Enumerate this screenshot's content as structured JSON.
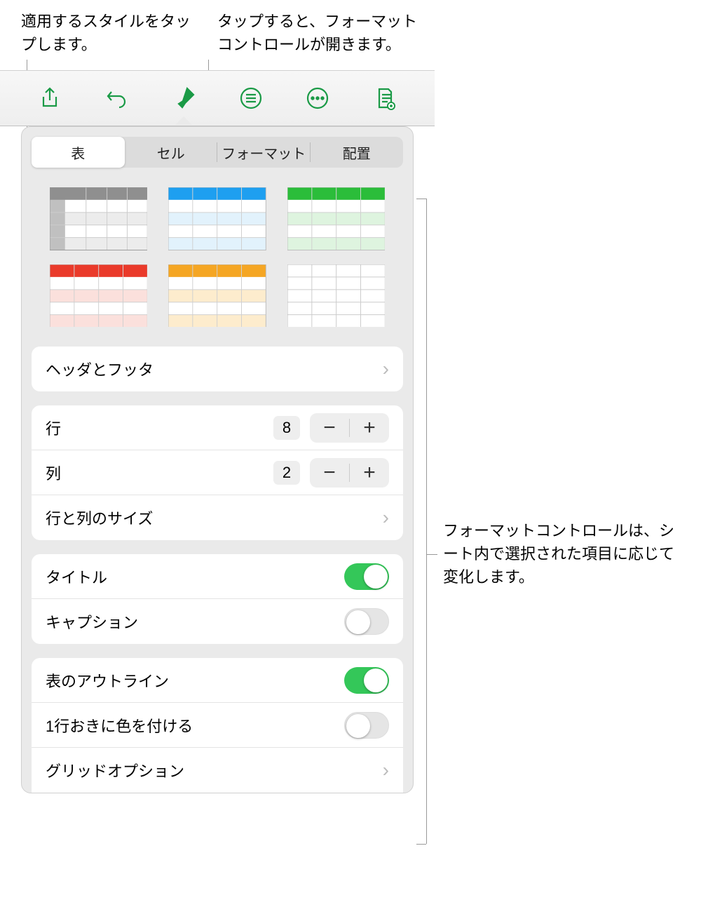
{
  "callouts": {
    "style": "適用するスタイルをタップします。",
    "brush": "タップすると、フォーマットコントロールが開きます。",
    "side": "フォーマットコントロールは、シート内で選択された項目に応じて変化します。"
  },
  "toolbar": {
    "items": [
      "share-icon",
      "undo-icon",
      "format-brush-icon",
      "list-icon",
      "more-icon",
      "document-view-icon"
    ]
  },
  "segmented": {
    "items": [
      {
        "label": "表",
        "active": true
      },
      {
        "label": "セル",
        "active": false
      },
      {
        "label": "フォーマット",
        "active": false
      },
      {
        "label": "配置",
        "active": false
      }
    ]
  },
  "styles": {
    "items": [
      {
        "name": "gray",
        "header_color": "#8f8f8f",
        "row_tint": "#e2e2e2"
      },
      {
        "name": "blue",
        "header_color": "#1e9ff0",
        "row_tint": "#d3ecfb"
      },
      {
        "name": "green",
        "header_color": "#2bbd3a",
        "row_tint": "#d4f0d6"
      },
      {
        "name": "red",
        "header_color": "#ea3a2a",
        "row_tint": "#fbd8d4"
      },
      {
        "name": "orange",
        "header_color": "#f5a623",
        "row_tint": "#fde9c9"
      },
      {
        "name": "plain",
        "header_color": "#ffffff",
        "row_tint": "#ffffff",
        "border": "#bbb"
      }
    ]
  },
  "groups": {
    "header_footer_label": "ヘッダとフッタ",
    "rows": {
      "label": "行",
      "value": "8"
    },
    "cols": {
      "label": "列",
      "value": "2"
    },
    "size_label": "行と列のサイズ",
    "title": {
      "label": "タイトル",
      "on": true
    },
    "caption": {
      "label": "キャプション",
      "on": false
    },
    "outline": {
      "label": "表のアウトライン",
      "on": true
    },
    "alternating": {
      "label": "1行おきに色を付ける",
      "on": false
    },
    "grid_label": "グリッドオプション"
  }
}
